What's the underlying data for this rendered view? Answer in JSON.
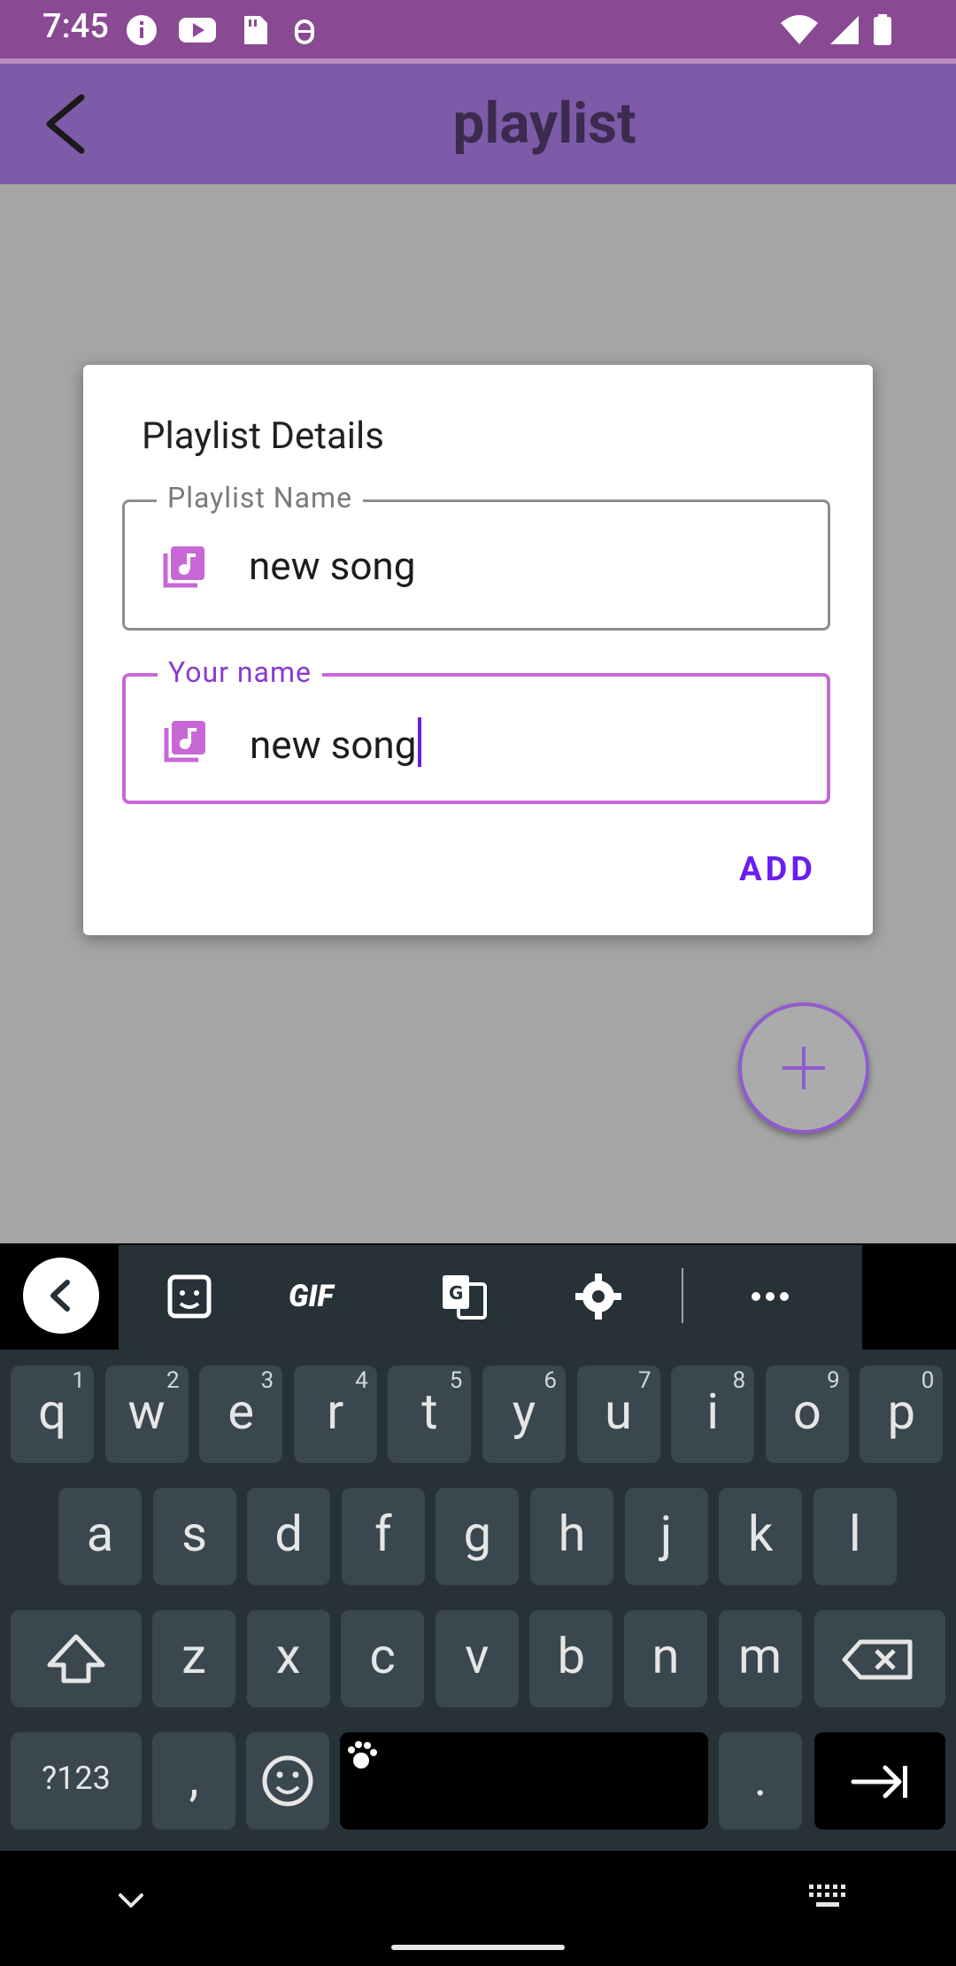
{
  "status_bar": {
    "time": "7:45",
    "colors": {
      "bg": "#8a4a93"
    }
  },
  "app_bar": {
    "title": "playlist",
    "back_icon": "arrow-back-icon",
    "colors": {
      "bg": "#7d5ba8"
    }
  },
  "dialog": {
    "title": "Playlist Details",
    "fields": [
      {
        "label": "Playlist Name",
        "value": "new song",
        "icon": "library-music-icon",
        "focused": false
      },
      {
        "label": "Your name",
        "value": "new song",
        "icon": "library-music-icon",
        "focused": true
      }
    ],
    "confirm_label": "ADD",
    "colors": {
      "accent": "#6a1ff0",
      "focus": "#c768d6"
    }
  },
  "fab": {
    "icon": "plus-icon"
  },
  "keyboard": {
    "toolbar": [
      "sticker-icon",
      "gif-icon",
      "translate-icon",
      "settings-icon",
      "more-icon"
    ],
    "toolbar_gif": "GIF",
    "row1": [
      {
        "k": "q",
        "h": "1"
      },
      {
        "k": "w",
        "h": "2"
      },
      {
        "k": "e",
        "h": "3"
      },
      {
        "k": "r",
        "h": "4"
      },
      {
        "k": "t",
        "h": "5"
      },
      {
        "k": "y",
        "h": "6"
      },
      {
        "k": "u",
        "h": "7"
      },
      {
        "k": "i",
        "h": "8"
      },
      {
        "k": "o",
        "h": "9"
      },
      {
        "k": "p",
        "h": "0"
      }
    ],
    "row2": [
      "a",
      "s",
      "d",
      "f",
      "g",
      "h",
      "j",
      "k",
      "l"
    ],
    "row3": [
      "z",
      "x",
      "c",
      "v",
      "b",
      "n",
      "m"
    ],
    "symbols_key": "?123",
    "comma_key": ",",
    "period_key": "."
  }
}
